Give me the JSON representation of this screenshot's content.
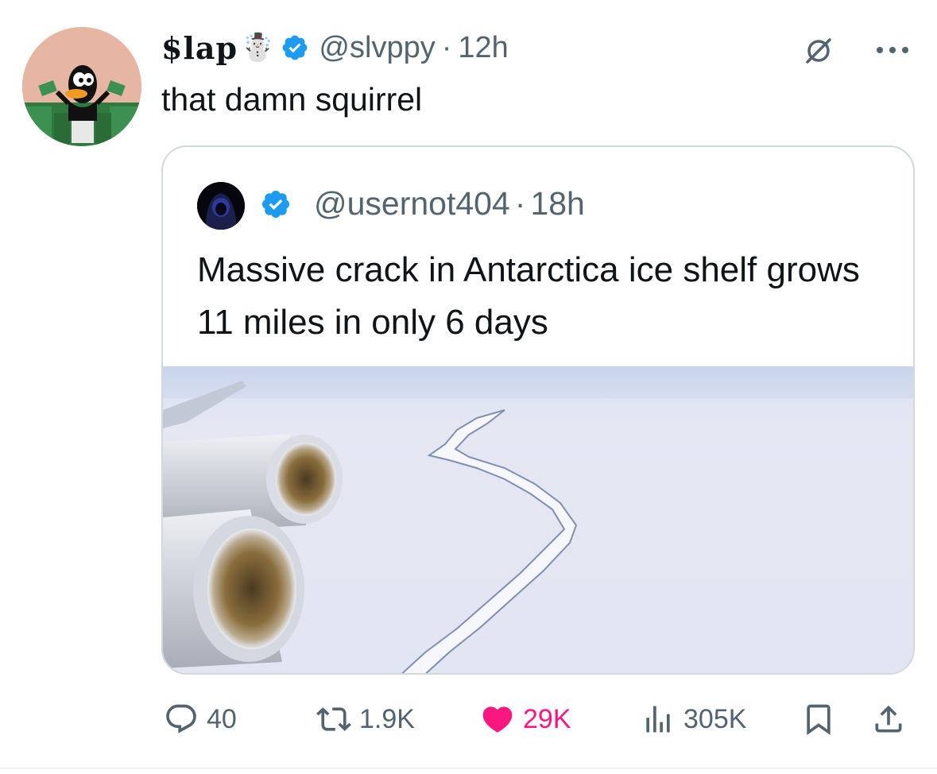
{
  "tweet": {
    "author": {
      "display_name": "$lap",
      "name_emoji": "☃️",
      "handle": "@slvppy",
      "separator": "·",
      "time": "12h",
      "verified": true,
      "avatar_icon": "daffy-duck-money-avatar"
    },
    "text": "that damn squirrel",
    "header_icons": [
      "grok-icon",
      "more-options-icon"
    ]
  },
  "quote": {
    "author": {
      "handle": "@usernot404",
      "separator": "·",
      "time": "18h",
      "verified": true,
      "avatar_icon": "hooded-figure-avatar"
    },
    "text": "Massive crack in Antarctica ice shelf grows 11 miles in only 6 days",
    "media": "airplane-engines-over-ice-shelf-crack-photo"
  },
  "actions": {
    "replies": "40",
    "reposts": "1.9K",
    "likes": "29K",
    "views": "305K",
    "liked": true
  },
  "colors": {
    "verified_blue": "#1d9bf0",
    "like_pink": "#f91880",
    "secondary_text": "#536471",
    "primary_text": "#0f1419",
    "border": "#cfd9de"
  }
}
